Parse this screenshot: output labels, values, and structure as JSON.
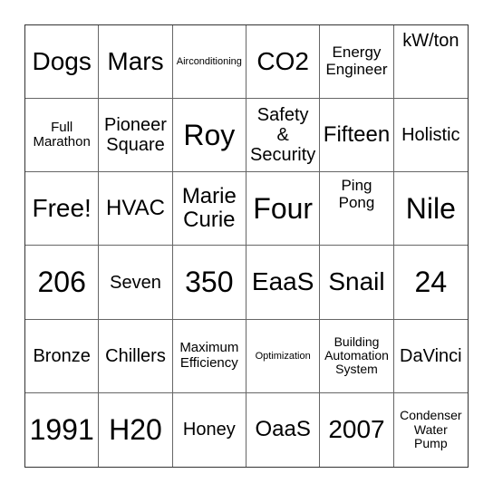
{
  "board": {
    "rows": [
      [
        "Dogs",
        "Mars",
        "Airconditioning",
        "CO2",
        "Energy\nEngineer",
        "kW/ton"
      ],
      [
        "Full\nMarathon",
        "Pioneer\nSquare",
        "Roy",
        "Safety\n&\nSecurity",
        "Fifteen",
        "Holistic"
      ],
      [
        "Free!",
        "HVAC",
        "Marie\nCurie",
        "Four",
        "Ping\nPong",
        "Nile"
      ],
      [
        "206",
        "Seven",
        "350",
        "EaaS",
        "Snail",
        "24"
      ],
      [
        "Bronze",
        "Chillers",
        "Maximum\nEfficiency",
        "Optimization",
        "Building\nAutomation\nSystem",
        "DaVinci"
      ],
      [
        "1991",
        "H20",
        "Honey",
        "OaaS",
        "2007",
        "Condenser\nWater\nPump"
      ]
    ]
  }
}
